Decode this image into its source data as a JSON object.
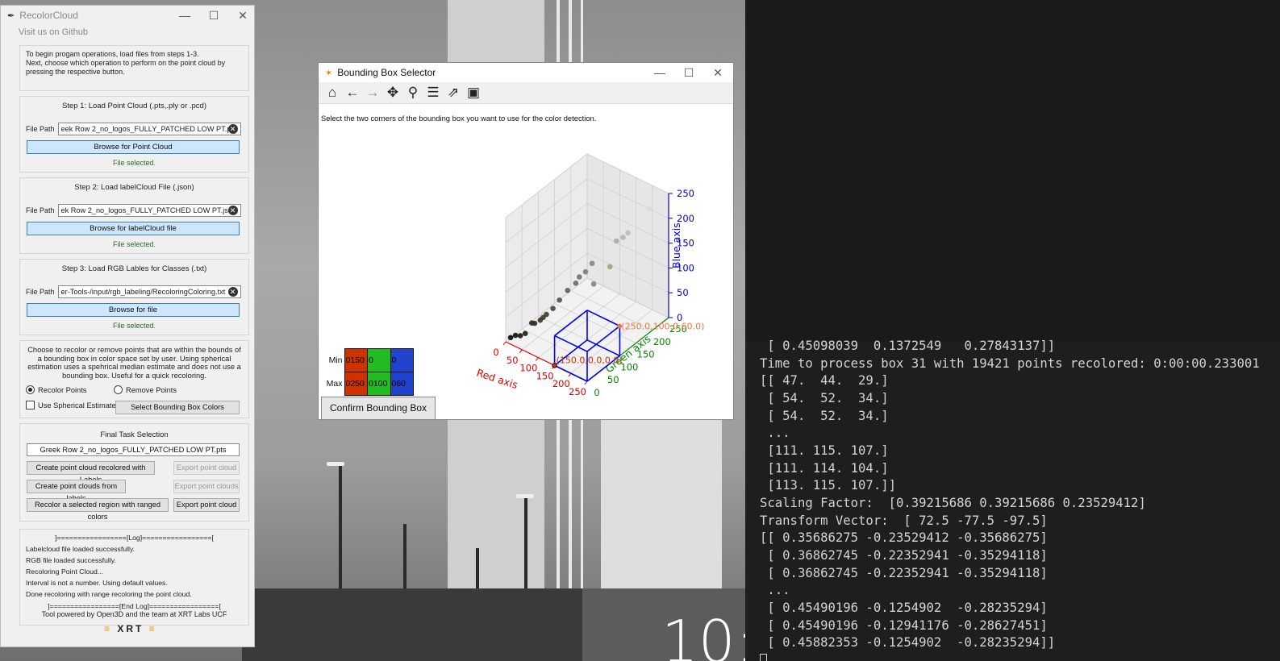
{
  "recolor_window": {
    "title": "RecolorCloud",
    "github_link": "Visit us on Github",
    "intro": "To begin progam operations, load files from steps 1-3.\nNext, choose which operation to perform on the point cloud by pressing the respective button.",
    "step1": {
      "title": "Step 1: Load Point Cloud (.pts,.ply or .pcd)",
      "label": "File Path",
      "value": "eek Row 2_no_logos_FULLY_PATCHED LOW PT.pts",
      "button": "Browse for Point Cloud",
      "status": "File selected."
    },
    "step2": {
      "title": "Step 2: Load labelCloud File (.json)",
      "label": "File Path",
      "value": "ek Row 2_no_logos_FULLY_PATCHED LOW PT.json",
      "button": "Browse for labelCloud file",
      "status": "File selected."
    },
    "step3": {
      "title": "Step 3: Load RGB Lables for Classes (.txt)",
      "label": "File Path",
      "value": "er-Tools-/input/rgb_labeling/RecoloringColoring.txt",
      "button": "Browse for file",
      "status": "File selected."
    },
    "options": {
      "description": "Choose to recolor or remove points that are within the bounds of a bounding box in color space set by user. Using spherical estimation uses a spehrical median estimate and does not use a bounding box. Useful for a quick recoloring.",
      "recolor": "Recolor Points",
      "remove": "Remove Points",
      "spherical": "Use Spherical Estimate",
      "select_button": "Select Bounding Box Colors"
    },
    "final": {
      "title": "Final Task Selection",
      "file": "Greek Row 2_no_logos_FULLY_PATCHED LOW PT.pts",
      "btn_labels": "Create point cloud recolored with Labels",
      "btn_export1": "Export point cloud",
      "btn_from_labels": "Create point clouds from labels",
      "btn_export2": "Export point clouds",
      "btn_ranged": "Recolor a selected region with ranged colors",
      "btn_export3": "Export point cloud"
    },
    "log": [
      "]=================[Log]=================[",
      "Labelcloud file loaded successfully.",
      "RGB file loaded successfully.",
      "Recoloring Point Cloud...",
      "Interval is not a number. Using default values.",
      "Done recoloring with range recoloring the point cloud.",
      "]=================[End Log]=================["
    ],
    "powered_by": "Tool powered by Open3D and the team at XRT Labs UCF",
    "logo_text": "XRT"
  },
  "bbox_window": {
    "title": "Bounding Box Selector",
    "instruction": "Select the two corners of the bounding box you want to use for the color detection.",
    "confirm_button": "Confirm Bounding Box",
    "toolbar_icons": [
      "home-icon",
      "back-icon",
      "forward-icon",
      "pan-icon",
      "zoom-icon",
      "configure-icon",
      "edit-axis-icon",
      "save-icon"
    ],
    "range_table": {
      "min_label": "Min",
      "max_label": "Max",
      "min": [
        "0150",
        "0",
        "0"
      ],
      "max": [
        "0250",
        "0100",
        "060"
      ],
      "colors": [
        "#cc3300",
        "#22bb22",
        "#2244cc"
      ]
    }
  },
  "chart_data": {
    "type": "scatter",
    "projection": "3d",
    "xlabel": "Red axis",
    "ylabel": "Green axis",
    "zlabel": "Blue axis",
    "xlim": [
      0,
      250
    ],
    "ylim": [
      0,
      250
    ],
    "zlim": [
      0,
      250
    ],
    "x_ticks": [
      "0",
      "50",
      "100",
      "150",
      "200",
      "250"
    ],
    "y_ticks": [
      "0",
      "50",
      "100",
      "150",
      "200",
      "250"
    ],
    "z_ticks": [
      "0",
      "50",
      "100",
      "150",
      "200",
      "250"
    ],
    "axis_colors": {
      "x": "#dd0000",
      "y": "#008800",
      "z": "#0000cc"
    },
    "points": [
      {
        "r": 5,
        "g": 10,
        "b": 5
      },
      {
        "r": 15,
        "g": 15,
        "b": 10
      },
      {
        "r": 25,
        "g": 20,
        "b": 10
      },
      {
        "r": 35,
        "g": 25,
        "b": 15
      },
      {
        "r": 40,
        "g": 40,
        "b": 30
      },
      {
        "r": 45,
        "g": 44,
        "b": 29
      },
      {
        "r": 54,
        "g": 52,
        "b": 34
      },
      {
        "r": 60,
        "g": 55,
        "b": 40
      },
      {
        "r": 65,
        "g": 60,
        "b": 45
      },
      {
        "r": 75,
        "g": 70,
        "b": 55
      },
      {
        "r": 85,
        "g": 80,
        "b": 70
      },
      {
        "r": 95,
        "g": 95,
        "b": 85
      },
      {
        "r": 105,
        "g": 110,
        "b": 95
      },
      {
        "r": 111,
        "g": 115,
        "b": 107
      },
      {
        "r": 120,
        "g": 125,
        "b": 115
      },
      {
        "r": 135,
        "g": 135,
        "b": 90
      },
      {
        "r": 130,
        "g": 135,
        "b": 130
      },
      {
        "r": 160,
        "g": 160,
        "b": 120
      },
      {
        "r": 170,
        "g": 170,
        "b": 170
      },
      {
        "r": 180,
        "g": 180,
        "b": 175
      },
      {
        "r": 190,
        "g": 185,
        "b": 185
      },
      {
        "r": 220,
        "g": 220,
        "b": 225
      }
    ],
    "bounding_box": {
      "min": [
        150,
        0,
        0
      ],
      "max": [
        250,
        100,
        60
      ]
    },
    "annotations": [
      "(150.0,0.0,0.0)",
      "(250.0,100.0,60.0)"
    ]
  },
  "terminal": {
    "lines": [
      " [ 0.45098039  0.1372549   0.27843137]]",
      "Time to process box 31 with 19421 points recolored: 0:00:00.233001",
      "[[ 47.  44.  29.]",
      " [ 54.  52.  34.]",
      " [ 54.  52.  34.]",
      " ...",
      " [111. 115. 107.]",
      " [111. 114. 104.]",
      " [113. 115. 107.]]",
      "Scaling Factor:  [0.39215686 0.39215686 0.23529412]",
      "Transform Vector:  [ 72.5 -77.5 -97.5]",
      "[[ 0.35686275 -0.23529412 -0.35686275]",
      " [ 0.36862745 -0.22352941 -0.35294118]",
      " [ 0.36862745 -0.22352941 -0.35294118]",
      " ...",
      " [ 0.45490196 -0.1254902  -0.28235294]",
      " [ 0.45490196 -0.12941176 -0.28627451]",
      " [ 0.45882353 -0.1254902  -0.28235294]]"
    ]
  },
  "desktop": {
    "clock_text": "10:"
  }
}
